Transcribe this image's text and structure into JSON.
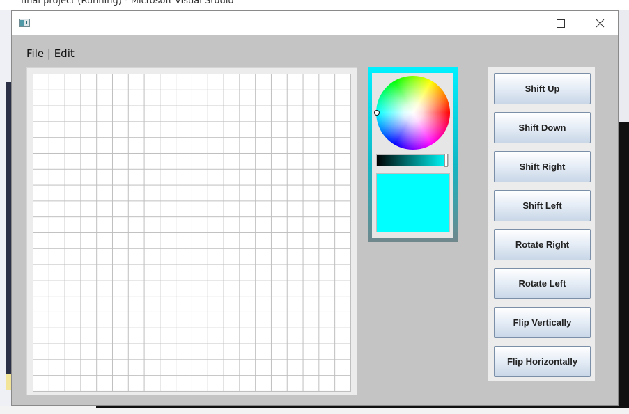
{
  "background_window": {
    "title": "final project (Running) - Microsoft Visual Studio"
  },
  "window": {
    "title": ""
  },
  "menu": {
    "label": "File | Edit"
  },
  "grid": {
    "columns": 20,
    "rows": 20
  },
  "color_picker": {
    "selected_color": "#00ffff",
    "brightness": 1.0
  },
  "buttons": [
    {
      "label": "Shift Up"
    },
    {
      "label": "Shift Down"
    },
    {
      "label": "Shift Right"
    },
    {
      "label": "Shift Left"
    },
    {
      "label": "Rotate Right"
    },
    {
      "label": "Rotate Left"
    },
    {
      "label": "Flip Vertically"
    },
    {
      "label": "Flip Horizontally"
    }
  ],
  "icons": {
    "minimize": "minimize-icon",
    "maximize": "maximize-icon",
    "close": "close-icon",
    "app": "java-app-icon"
  },
  "colors": {
    "window_bg": "#c4c4c4",
    "accent_cyan": "#00ffff"
  }
}
